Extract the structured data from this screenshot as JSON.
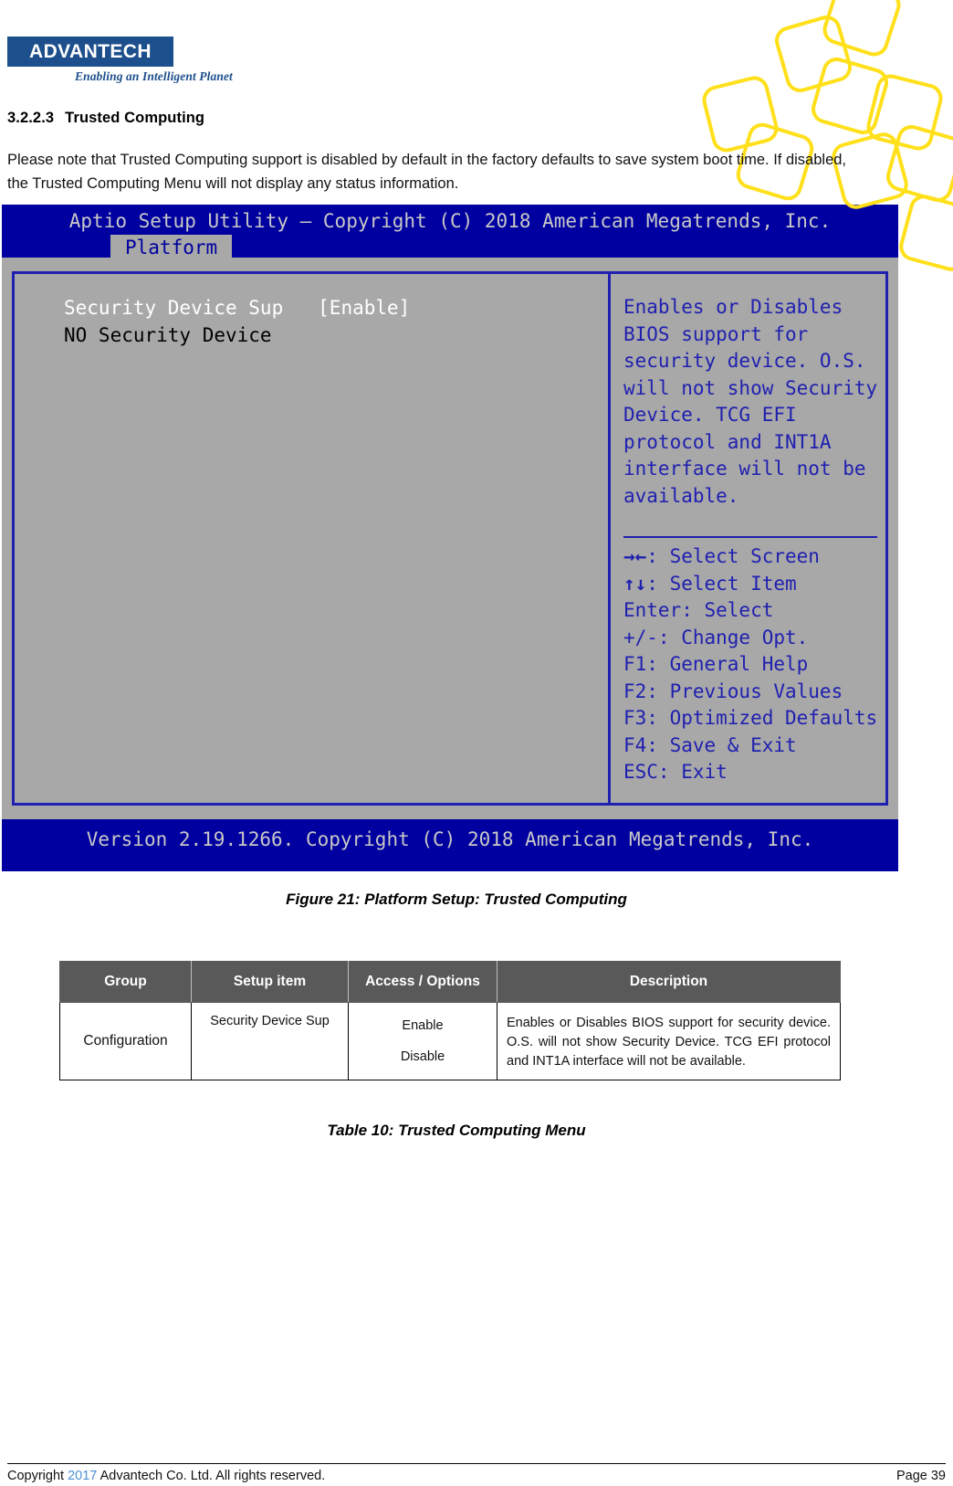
{
  "brand": {
    "logo_text": "ADVANTECH",
    "tagline": "Enabling an Intelligent Planet",
    "logo_color": "#1D4F8C",
    "accent_color": "#FFE01B"
  },
  "section": {
    "number": "3.2.2.3",
    "title": "Trusted Computing",
    "intro": "Please note that Trusted Computing support is disabled by default in the factory defaults to save system boot time. If disabled, the Trusted Computing Menu will not display any status information."
  },
  "bios": {
    "title": "Aptio Setup Utility – Copyright (C) 2018 American Megatrends, Inc.",
    "tab": "Platform",
    "items": [
      {
        "label": "Security Device Sup",
        "value": "[Enable]"
      },
      {
        "label": "NO Security Device",
        "value": ""
      }
    ],
    "help_lines": [
      "Enables or Disables",
      "BIOS support for",
      "security device. O.S.",
      "will not show Security",
      "Device. TCG EFI",
      "protocol and INT1A",
      "interface will not be",
      "available."
    ],
    "keys": [
      {
        "glyph": "→←",
        "text": ": Select Screen"
      },
      {
        "glyph": "↑↓",
        "text": ": Select Item"
      },
      {
        "glyph": "",
        "text": "Enter: Select"
      },
      {
        "glyph": "",
        "text": "+/-: Change Opt."
      },
      {
        "glyph": "",
        "text": "F1: General Help"
      },
      {
        "glyph": "",
        "text": "F2: Previous Values"
      },
      {
        "glyph": "",
        "text": "F3: Optimized Defaults"
      },
      {
        "glyph": "",
        "text": "F4: Save & Exit"
      },
      {
        "glyph": "",
        "text": "ESC: Exit"
      }
    ],
    "version": "Version 2.19.1266. Copyright (C) 2018 American Megatrends, Inc."
  },
  "figure_caption": "Figure 21: Platform Setup: Trusted Computing",
  "table_caption": "Table 10: Trusted Computing Menu",
  "table": {
    "headers": [
      "Group",
      "Setup item",
      "Access / Options",
      "Description"
    ],
    "rows": [
      {
        "group": "Configuration",
        "setup_item": "Security Device Sup",
        "options": [
          "Enable",
          "Disable"
        ],
        "description": "Enables or Disables BIOS support for security device. O.S. will not show Security Device. TCG EFI protocol and INT1A interface will not be available."
      }
    ]
  },
  "footer": {
    "copyright_prefix": "Copyright",
    "year": "2017",
    "copyright_suffix": "Advantech Co. Ltd. All rights reserved.",
    "page": "Page 39"
  }
}
